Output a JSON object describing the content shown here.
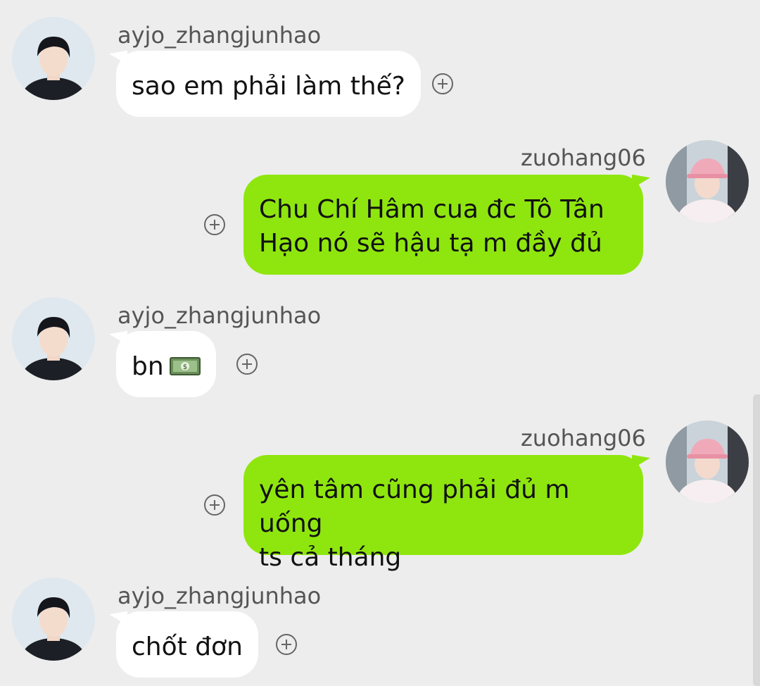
{
  "messages": [
    {
      "sender": "ayjo_zhangjunhao",
      "direction": "incoming",
      "text": "sao em phải làm thế?"
    },
    {
      "sender": "zuohang06",
      "direction": "outgoing",
      "lines": [
        "Chu Chí Hâm cua đc Tô Tân",
        "Hạo nó sẽ hậu tạ m đầy đủ"
      ]
    },
    {
      "sender": "ayjo_zhangjunhao",
      "direction": "incoming",
      "text": "bn",
      "emoji": "dollar-banknote-icon"
    },
    {
      "sender": "zuohang06",
      "direction": "outgoing",
      "lines": [
        "yên tâm cũng phải đủ m uống",
        "ts cả tháng"
      ]
    },
    {
      "sender": "ayjo_zhangjunhao",
      "direction": "incoming",
      "text": "chốt đơn"
    }
  ],
  "colors": {
    "background": "#ededed",
    "incoming_bubble": "#ffffff",
    "outgoing_bubble": "#8fe60e",
    "username": "#555555"
  },
  "icons": {
    "reaction": "plus-circle-icon",
    "incoming_avatar": "avatar-photo",
    "outgoing_avatar": "avatar-photo"
  }
}
